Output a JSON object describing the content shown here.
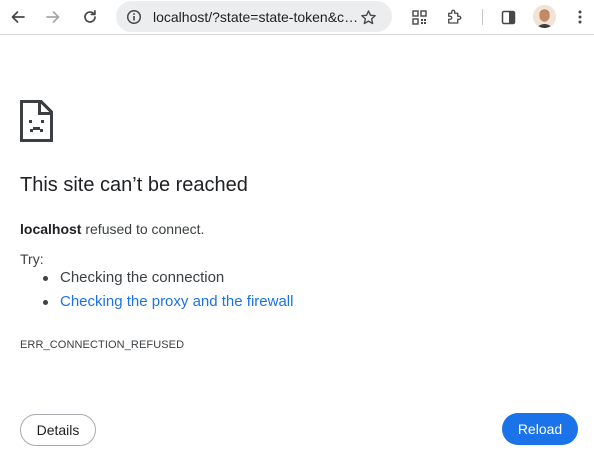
{
  "toolbar": {
    "back_icon": "arrow-left-icon",
    "forward_icon": "arrow-right-icon",
    "reload_icon": "reload-icon",
    "address_bar": {
      "info_icon": "info-icon",
      "url": "localhost/?state=state-token&code=...",
      "bookmark_icon": "star-icon"
    },
    "qr_icon": "qr-code-icon",
    "extensions_icon": "puzzle-icon",
    "side_panel_icon": "side-panel-icon",
    "profile_icon": "avatar",
    "menu_icon": "kebab-menu-icon"
  },
  "error_page": {
    "icon": "sad-page-icon",
    "title": "This site can’t be reached",
    "host": "localhost",
    "message": "refused to connect.",
    "try_label": "Try:",
    "suggestions": [
      {
        "text": "Checking the connection",
        "is_link": false
      },
      {
        "text": "Checking the proxy and the firewall",
        "is_link": true
      }
    ],
    "error_code": "ERR_CONNECTION_REFUSED",
    "details_label": "Details",
    "reload_label": "Reload"
  },
  "colors": {
    "accent": "#1a73e8",
    "text": "#202124",
    "secondary_text": "#3c4043",
    "omnibox_bg": "#ecedef"
  }
}
